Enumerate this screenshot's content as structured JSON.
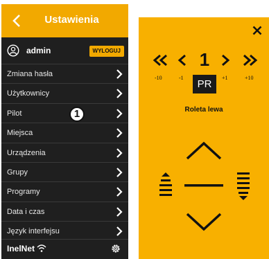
{
  "left_panel": {
    "header_title": "Ustawienia",
    "user_name": "admin",
    "logout_label": "WYLOGUJ",
    "menu_items": [
      {
        "label": "Zmiana hasła"
      },
      {
        "label": "Użytkownicy"
      },
      {
        "label": "Pilot"
      },
      {
        "label": "Miejsca"
      },
      {
        "label": "Urządzenia"
      },
      {
        "label": "Grupy"
      },
      {
        "label": "Programy"
      },
      {
        "label": "Data i czas"
      },
      {
        "label": "Język interfejsu"
      }
    ],
    "brand": "InelNet",
    "annotation_marker": "1"
  },
  "right_panel": {
    "channel_number": "1",
    "tick_labels": [
      "-10",
      "-1",
      "+1",
      "+10"
    ],
    "mode_label": "PR",
    "device_name": "Roleta lewa"
  },
  "colors": {
    "accent": "#f2a900",
    "remote_bg": "#f8b000",
    "menu_bg": "#1f1f1f",
    "divider": "#3a3a3a"
  },
  "icons": [
    "back-icon",
    "user-icon",
    "chevron-right-icon",
    "wifi-icon",
    "gear-icon",
    "close-icon",
    "double-chevron-left-icon",
    "chevron-left-icon",
    "chevron-right-icon",
    "double-chevron-right-icon",
    "up-arrow-icon",
    "stop-bar-icon",
    "down-arrow-icon",
    "step-up-icon",
    "step-down-icon"
  ]
}
